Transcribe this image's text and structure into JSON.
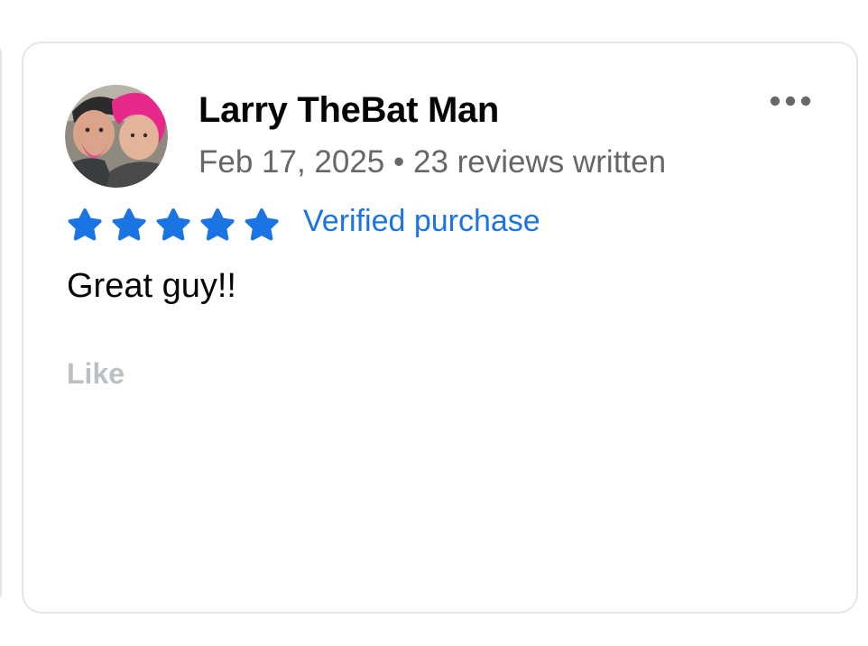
{
  "review": {
    "author_name": "Larry TheBat Man",
    "date": "Feb 17, 2025",
    "separator": " • ",
    "reviews_written": "23 reviews written",
    "rating": 5,
    "rating_max": 5,
    "verified_label": "Verified purchase",
    "text": "Great guy!!",
    "like_label": "Like"
  },
  "icons": {
    "more": "more-options-icon",
    "star": "star-icon",
    "avatar": "avatar"
  },
  "colors": {
    "accent": "#1b74e4",
    "name": "#050505",
    "meta": "#65676b",
    "like": "#bcc0c4",
    "card_border": "#e4e6eb"
  }
}
